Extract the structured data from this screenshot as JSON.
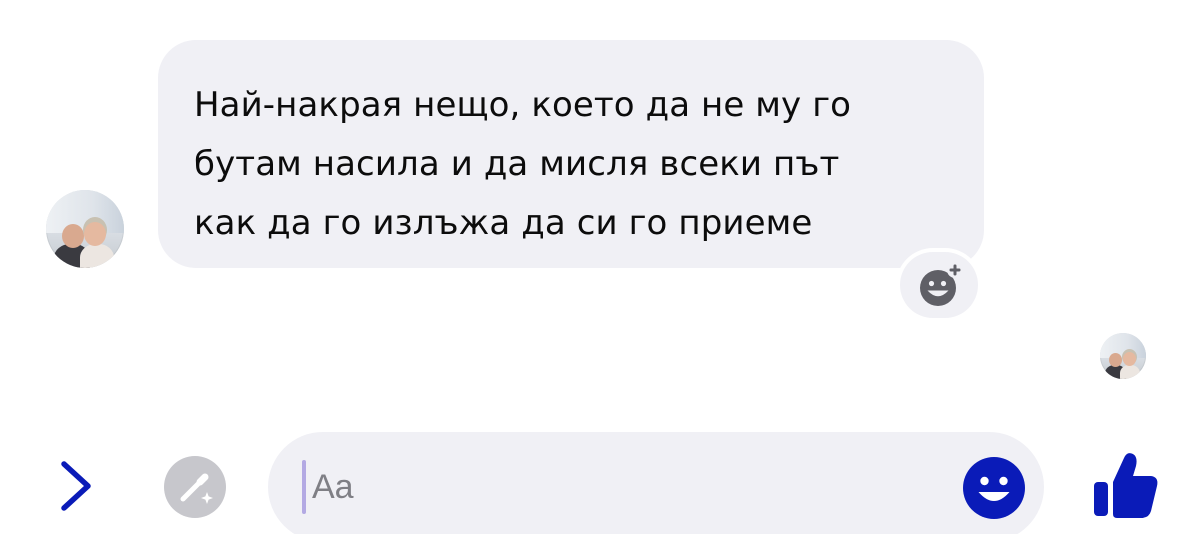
{
  "conversation": {
    "received_message": {
      "lines": [
        "Най-накрая нещо, което да не му го",
        "бутам насила и да мисля всеки път",
        "как да го излъжа да си го приеме"
      ]
    },
    "reaction_button": {
      "icon": "emoji-add-icon"
    },
    "sender_avatar": {
      "icon": "avatar-photo"
    },
    "read_receipt_avatar": {
      "icon": "avatar-photo"
    }
  },
  "composer": {
    "placeholder": "Aa",
    "value": "",
    "expand_icon": "chevron-right-icon",
    "magic_icon": "magic-wand-icon",
    "emoji_icon": "smiley-icon",
    "like_icon": "thumbs-up-icon"
  },
  "colors": {
    "accent": "#0a1bb8",
    "bubble": "#f0f0f5",
    "text": "#0c0c0c",
    "placeholder": "#7f7f85",
    "magic_button": "#c7c7cc",
    "caret": "#b3a9e3"
  }
}
